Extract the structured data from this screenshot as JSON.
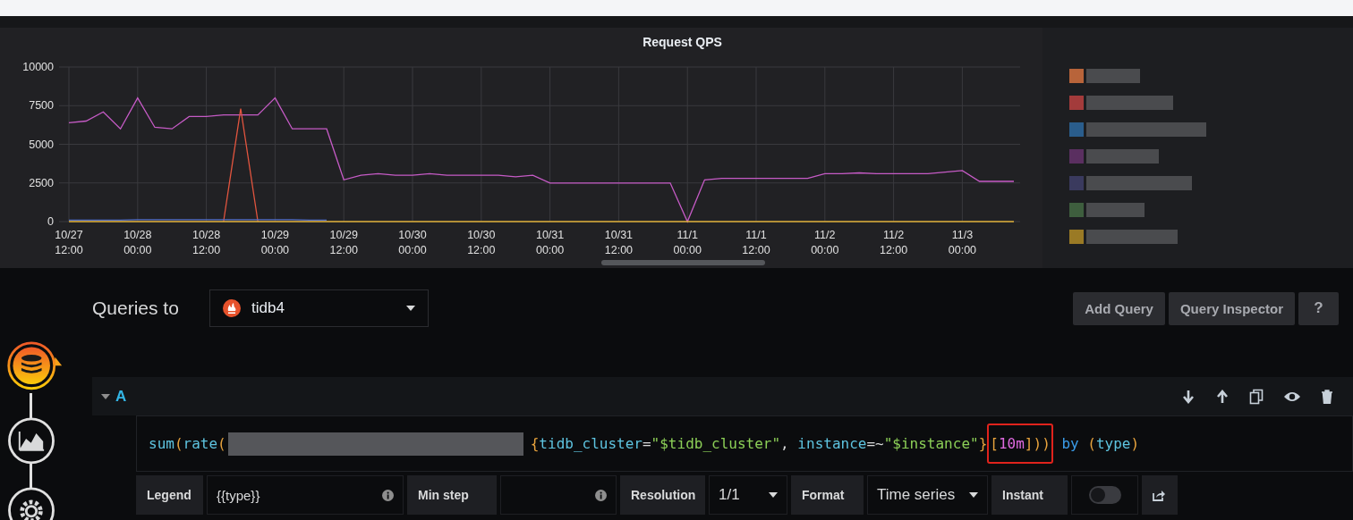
{
  "chart": {
    "chart_data": {
      "type": "line",
      "title": "Request QPS",
      "categories": [
        "10/27 12:00",
        null,
        null,
        null,
        "10/28 00:00",
        null,
        null,
        null,
        "10/28 12:00",
        null,
        null,
        null,
        "10/29 00:00",
        null,
        null,
        null,
        "10/29 12:00",
        null,
        null,
        null,
        "10/30 00:00",
        null,
        null,
        null,
        "10/30 12:00",
        null,
        null,
        null,
        "10/31 00:00",
        null,
        null,
        null,
        "10/31 12:00",
        null,
        null,
        null,
        "11/1 00:00",
        null,
        null,
        null,
        "11/1 12:00",
        null,
        null,
        null,
        "11/2 00:00",
        null,
        null,
        null,
        "11/2 12:00",
        null,
        null,
        null,
        "11/3 00:00",
        null,
        null,
        null
      ],
      "series": [
        {
          "color": "#c65bc6",
          "values": [
            6400,
            6500,
            7100,
            6000,
            8000,
            6100,
            6000,
            6800,
            6800,
            6900,
            6900,
            6900,
            8000,
            6000,
            6000,
            6000,
            2700,
            3000,
            3100,
            3000,
            3000,
            3100,
            3000,
            3000,
            3000,
            3000,
            2900,
            3000,
            2500,
            2500,
            2500,
            2500,
            2500,
            2500,
            2500,
            2500,
            0,
            2700,
            2800,
            2800,
            2800,
            2800,
            2800,
            2800,
            3100,
            3100,
            3150,
            3100,
            3100,
            3100,
            3100,
            3200,
            3300,
            2600,
            2600,
            2600
          ]
        },
        {
          "color": "#e2553f",
          "values": [
            null,
            null,
            null,
            null,
            null,
            null,
            null,
            null,
            null,
            0,
            7300,
            0,
            null,
            null,
            null,
            null,
            null,
            null,
            null,
            null,
            null,
            null,
            null,
            null,
            null,
            null,
            null,
            null,
            null,
            null,
            null,
            null,
            null,
            null,
            null,
            null,
            null,
            null,
            null,
            null,
            null,
            null,
            null,
            null,
            null,
            null,
            null,
            null,
            null,
            null,
            null,
            null,
            null,
            null,
            null,
            null
          ]
        },
        {
          "color": "#5470c8",
          "values": [
            100,
            100,
            100,
            100,
            120,
            120,
            120,
            120,
            120,
            120,
            120,
            120,
            120,
            120,
            100,
            100,
            null,
            null,
            null,
            null,
            null,
            null,
            null,
            null,
            null,
            null,
            null,
            null,
            null,
            null,
            null,
            null,
            null,
            null,
            null,
            null,
            null,
            null,
            null,
            null,
            null,
            null,
            null,
            null,
            null,
            null,
            null,
            null,
            null,
            null,
            null,
            null,
            null,
            null,
            null,
            null
          ]
        },
        {
          "color": "#e0b13a",
          "values": [
            0,
            0,
            0,
            0,
            0,
            0,
            0,
            0,
            0,
            0,
            0,
            0,
            0,
            0,
            0,
            0,
            0,
            0,
            0,
            0,
            0,
            0,
            0,
            0,
            0,
            0,
            0,
            0,
            0,
            0,
            0,
            0,
            0,
            0,
            0,
            0,
            0,
            0,
            0,
            0,
            0,
            0,
            0,
            0,
            0,
            0,
            0,
            0,
            0,
            0,
            0,
            0,
            0,
            0,
            0,
            0
          ]
        }
      ],
      "grid": true,
      "ylim": [
        0,
        10000
      ],
      "yticks": [
        0,
        2500,
        5000,
        7500,
        10000
      ]
    }
  },
  "legend": [
    {
      "color": "#b8643a"
    },
    {
      "color": "#a33b3b"
    },
    {
      "color": "#2a5d8c"
    },
    {
      "color": "#5a2f60"
    },
    {
      "color": "#3a3a5e"
    },
    {
      "color": "#3e5e3e"
    },
    {
      "color": "#9a7a25"
    }
  ],
  "queries_to": {
    "label": "Queries to",
    "datasource": "tidb4"
  },
  "buttons": [
    "Add Query",
    "Query Inspector",
    "?"
  ],
  "query": {
    "ref": "A",
    "expanded": true,
    "prefix": [
      {
        "text": "sum",
        "kind": "func"
      },
      {
        "text": "(",
        "kind": "paren"
      },
      {
        "text": "rate",
        "kind": "func"
      },
      {
        "text": "(",
        "kind": "paren"
      }
    ],
    "suffix": [
      {
        "text": "{",
        "kind": "paren",
        "boxed": false
      },
      {
        "text": "tidb_cluster",
        "kind": "label",
        "boxed": false
      },
      {
        "text": "=",
        "kind": "punct",
        "boxed": false
      },
      {
        "text": "\"$tidb_cluster\"",
        "kind": "string",
        "boxed": false
      },
      {
        "text": ", ",
        "kind": "punct",
        "boxed": false
      },
      {
        "text": "instance",
        "kind": "label",
        "boxed": false
      },
      {
        "text": "=~",
        "kind": "punct",
        "boxed": false
      },
      {
        "text": "\"$instance\"",
        "kind": "string",
        "boxed": false
      },
      {
        "text": "}",
        "kind": "paren",
        "boxed": false
      },
      {
        "text": "[",
        "kind": "paren",
        "boxed": true
      },
      {
        "text": "10m",
        "kind": "number",
        "boxed": true
      },
      {
        "text": "]",
        "kind": "paren",
        "boxed": true
      },
      {
        "text": ")",
        "kind": "paren",
        "boxed": true
      },
      {
        "text": ")",
        "kind": "paren",
        "boxed": true
      },
      {
        "text": " by ",
        "kind": "keyword",
        "boxed": false
      },
      {
        "text": "(",
        "kind": "paren",
        "boxed": false
      },
      {
        "text": "type",
        "kind": "label",
        "boxed": false
      },
      {
        "text": ")",
        "kind": "paren",
        "boxed": false
      }
    ]
  },
  "options": {
    "legend_label": "Legend",
    "legend_value": "{{type}}",
    "min_step_label": "Min step",
    "resolution_label": "Resolution",
    "resolution_value": "1/1",
    "format_label": "Format",
    "format_value": "Time series",
    "instant_label": "Instant",
    "instant_on": false
  }
}
